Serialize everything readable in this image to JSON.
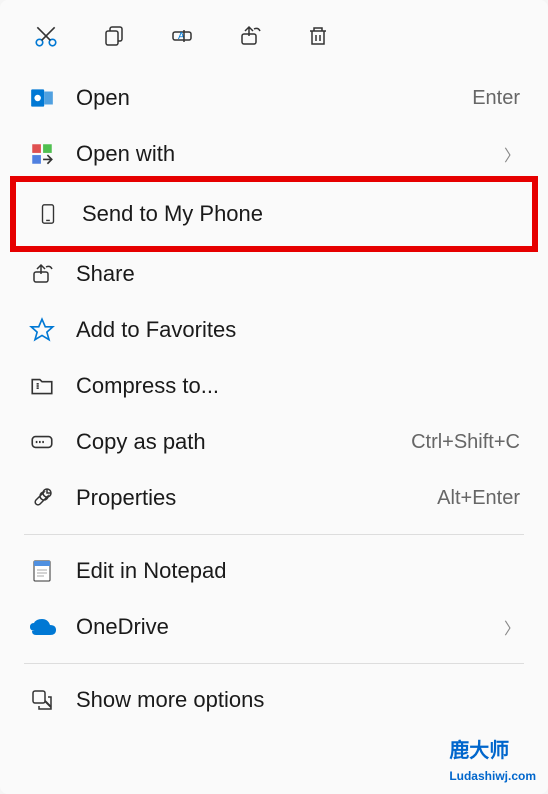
{
  "toolbar": {
    "cut": "cut",
    "copy": "copy",
    "rename": "rename",
    "share": "share",
    "delete": "delete"
  },
  "menu": {
    "open": {
      "label": "Open",
      "shortcut": "Enter"
    },
    "open_with": {
      "label": "Open with"
    },
    "send_to_phone": {
      "label": "Send to My Phone"
    },
    "share": {
      "label": "Share"
    },
    "add_favorites": {
      "label": "Add to Favorites"
    },
    "compress": {
      "label": "Compress to..."
    },
    "copy_path": {
      "label": "Copy as path",
      "shortcut": "Ctrl+Shift+C"
    },
    "properties": {
      "label": "Properties",
      "shortcut": "Alt+Enter"
    },
    "edit_notepad": {
      "label": "Edit in Notepad"
    },
    "onedrive": {
      "label": "OneDrive"
    },
    "show_more": {
      "label": "Show more options"
    }
  },
  "watermark": {
    "title": "鹿大师",
    "sub": "Ludashiwj.com"
  }
}
